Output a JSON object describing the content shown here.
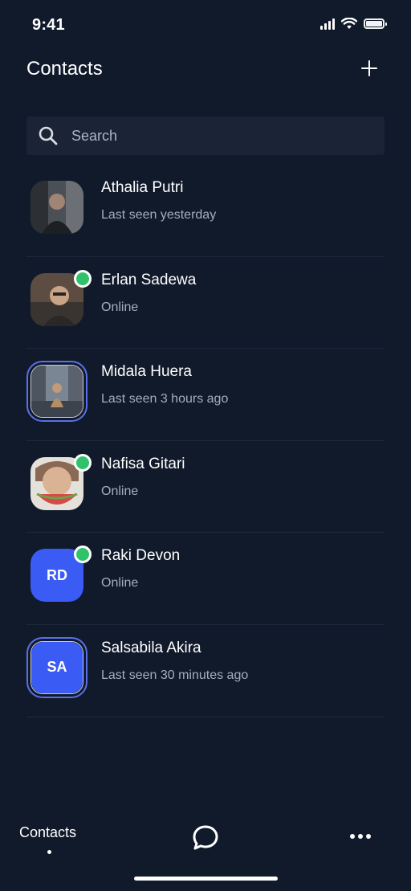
{
  "status_bar": {
    "time": "9:41"
  },
  "header": {
    "title": "Contacts",
    "add_icon": "plus-icon"
  },
  "search": {
    "placeholder": "Search",
    "icon": "search-icon"
  },
  "contacts": [
    {
      "name": "Athalia Putri",
      "status": "Last seen yesterday",
      "online": false,
      "has_story": false,
      "initials": "",
      "photo_colors": [
        "#3a3f45",
        "#8b8f92",
        "#1f2226"
      ]
    },
    {
      "name": "Erlan Sadewa",
      "status": "Online",
      "online": true,
      "has_story": false,
      "initials": "",
      "photo_colors": [
        "#6b5a4e",
        "#c8a98c",
        "#2d2a2a"
      ]
    },
    {
      "name": "Midala Huera",
      "status": "Last seen 3 hours ago",
      "online": false,
      "has_story": true,
      "initials": "",
      "photo_colors": [
        "#7c8a98",
        "#b8a58a",
        "#3c4450"
      ]
    },
    {
      "name": "Nafisa Gitari",
      "status": "Online",
      "online": true,
      "has_story": false,
      "initials": "",
      "photo_colors": [
        "#e6e2dc",
        "#d9574f",
        "#9c7b66"
      ]
    },
    {
      "name": "Raki Devon",
      "status": "Online",
      "online": true,
      "has_story": false,
      "initials": "RD",
      "photo_colors": []
    },
    {
      "name": "Salsabila Akira",
      "status": "Last seen 30 minutes ago",
      "online": false,
      "has_story": true,
      "initials": "SA",
      "photo_colors": []
    }
  ],
  "bottom_nav": {
    "contacts_label": "Contacts",
    "chat_icon": "chat-bubble-icon",
    "more_icon": "more-dots-icon"
  },
  "colors": {
    "background": "#111a2b",
    "accent": "#3b5bf5",
    "online": "#2fc26b"
  }
}
